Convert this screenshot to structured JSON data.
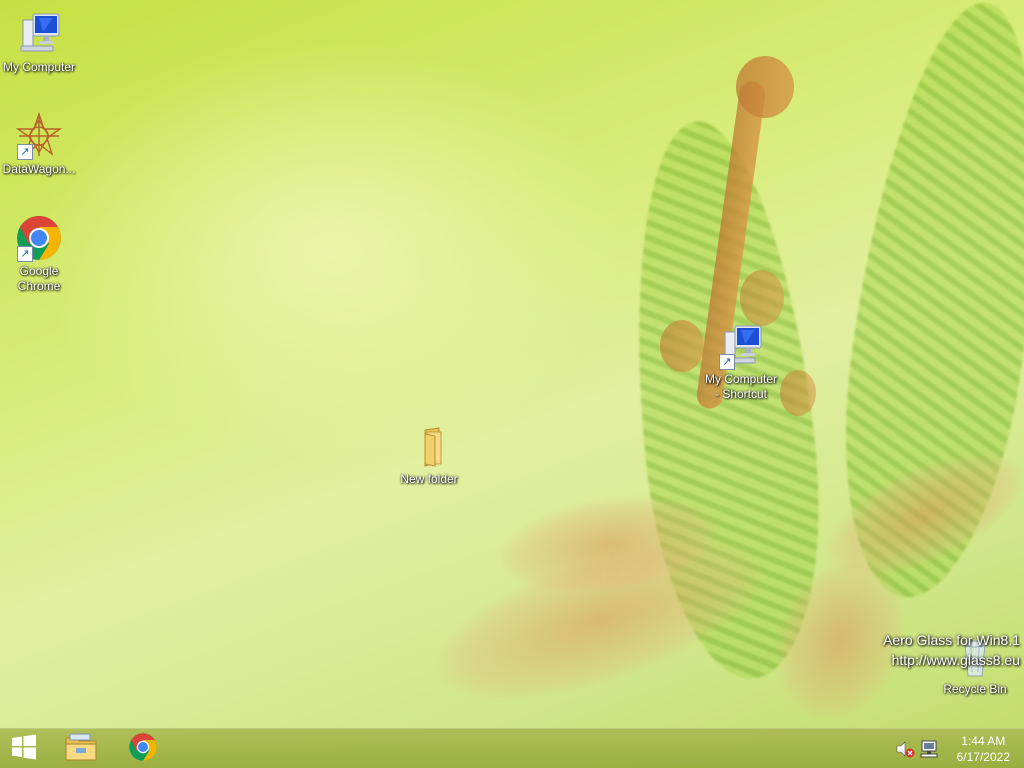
{
  "desktop": {
    "icons": [
      {
        "label": "My Computer",
        "icon": "computer-icon"
      },
      {
        "label": "DataWagon...",
        "icon": "datawagon-icon"
      },
      {
        "label": "Google\nChrome",
        "icon": "chrome-icon"
      },
      {
        "label": "My Computer\n- Shortcut",
        "icon": "computer-icon"
      },
      {
        "label": "New folder",
        "icon": "folder-icon"
      },
      {
        "label": "Recycle Bin",
        "icon": "recycle-bin-icon"
      }
    ]
  },
  "watermark": {
    "line1": "Aero Glass for Win8.1",
    "line2": "http://www.glass8.eu"
  },
  "taskbar": {
    "pinned": [
      {
        "icon": "windows-start-icon"
      },
      {
        "icon": "file-explorer-icon"
      },
      {
        "icon": "chrome-icon"
      }
    ],
    "tray": {
      "volume": "volume-muted-icon",
      "network": "network-icon"
    },
    "clock": {
      "time": "1:44 AM",
      "date": "6/17/2022"
    }
  },
  "colors": {
    "wallpaper_base": "#d8ec7a",
    "taskbar": "#a4b650",
    "chrome_red": "#db4437",
    "chrome_yellow": "#f4b400",
    "chrome_green": "#0f9d58",
    "chrome_blue": "#4285f4"
  }
}
